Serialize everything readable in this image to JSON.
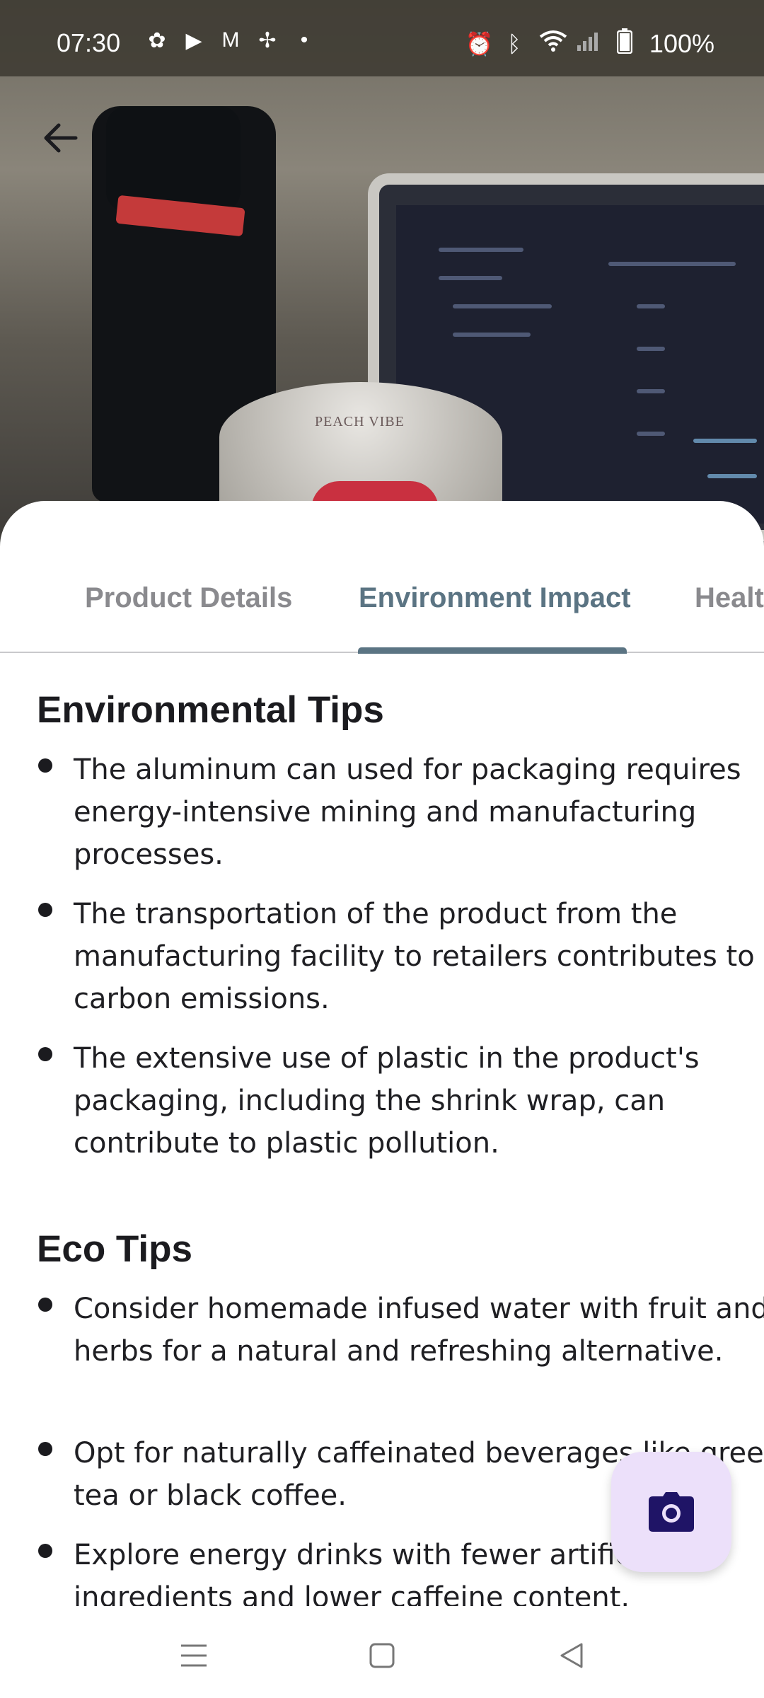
{
  "status_bar": {
    "time": "07:30",
    "notification_icons": [
      "app-icon",
      "youtube-icon",
      "gmail-icon",
      "pinwheel-icon",
      "dot-icon"
    ],
    "system_icons": [
      "alarm-icon",
      "bluetooth-icon",
      "wifi-icon",
      "signal-icon",
      "battery-icon"
    ],
    "battery": "100%"
  },
  "hero": {
    "back_icon": "arrow-left-icon",
    "can_label": "PEACH VIBE"
  },
  "tabs": [
    {
      "label": "Product Details",
      "active": false
    },
    {
      "label": "Environment Impact",
      "active": true
    },
    {
      "label": "Healt",
      "active": false
    }
  ],
  "environmental_tips": {
    "title": "Environmental Tips",
    "items": [
      "The aluminum can used for packaging requires energy-intensive mining and manufacturing processes.",
      "The transportation of the product from the manufacturing facility to retailers contributes to carbon emissions.",
      "The extensive use of plastic in the product's packaging, including the shrink wrap, can contribute to plastic pollution."
    ]
  },
  "eco_tips": {
    "title": "Eco Tips",
    "items": [
      "Consider homemade infused water with fruit and herbs for a natural and refreshing alternative.",
      "Opt for naturally caffeinated beverages like green tea or black coffee.",
      "Explore energy drinks with fewer artificial ingredients and lower caffeine content."
    ]
  },
  "fab": {
    "icon": "camera-icon"
  },
  "nav_bar": {
    "icons": [
      "menu-icon",
      "home-square-icon",
      "back-triangle-icon"
    ]
  },
  "colors": {
    "accent": "#5b7483",
    "fab_bg": "#ece0fa",
    "fab_icon": "#1f1466",
    "tab_inactive": "#8a8a8e",
    "text": "#1b1b1f"
  }
}
